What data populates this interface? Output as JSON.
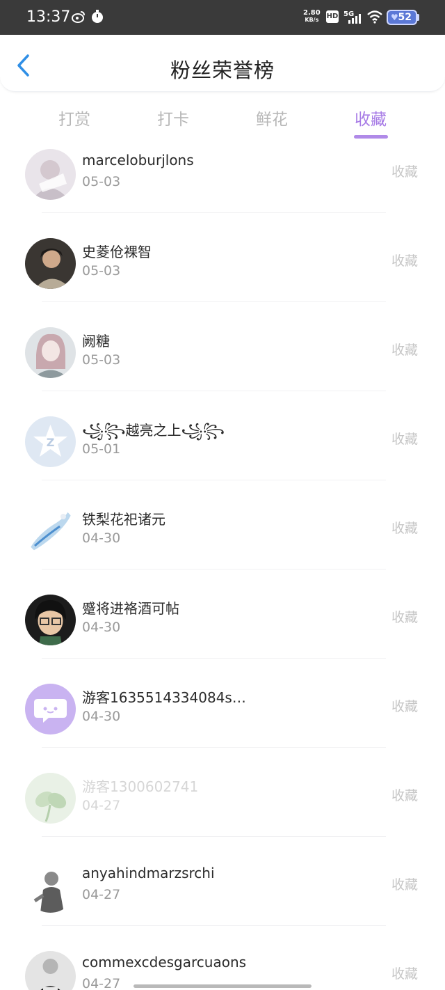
{
  "status_bar": {
    "time": "13:37",
    "net_speed_value": "2.80",
    "net_speed_unit": "KB/s",
    "hd": "HD",
    "network": "5G",
    "battery": "52"
  },
  "header": {
    "title": "粉丝荣誉榜"
  },
  "tabs": [
    {
      "label": "打赏",
      "active": false
    },
    {
      "label": "打卡",
      "active": false
    },
    {
      "label": "鲜花",
      "active": false
    },
    {
      "label": "收藏",
      "active": true
    }
  ],
  "colors": {
    "accent": "#b08ae8",
    "muted": "#b7b7b7",
    "date": "#9a9a9a"
  },
  "items": [
    {
      "name": "marceloburjlons",
      "date": "05-03",
      "action": "收藏"
    },
    {
      "name": "史菱伧裸智",
      "date": "05-03",
      "action": "收藏"
    },
    {
      "name": "阙糖",
      "date": "05-03",
      "action": "收藏"
    },
    {
      "name": "꧁꧂越亮之上꧁꧂",
      "date": "05-01",
      "action": "收藏"
    },
    {
      "name": "铁梨花祀诸元",
      "date": "04-30",
      "action": "收藏"
    },
    {
      "name": "蹙将进袼酒可帖",
      "date": "04-30",
      "action": "收藏"
    },
    {
      "name": "游客1635514334084s…",
      "date": "04-30",
      "action": "收藏"
    },
    {
      "name": "游客1300602741",
      "date": "04-27",
      "action": "收藏"
    },
    {
      "name": "anyahindmarzsrchi",
      "date": "04-27",
      "action": "收藏"
    },
    {
      "name": "commexcdesgarcuaons",
      "date": "04-27",
      "action": "收藏"
    }
  ]
}
